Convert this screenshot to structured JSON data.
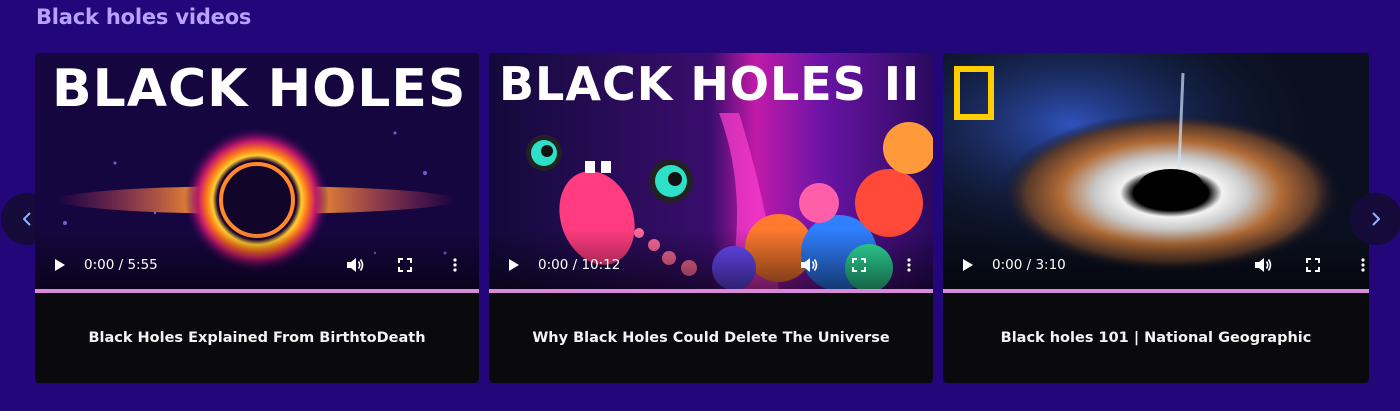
{
  "section": {
    "title": "Black holes videos"
  },
  "navigation": {
    "prev_icon": "chevron-left-icon",
    "next_icon": "chevron-right-icon"
  },
  "colors": {
    "page_background": "#23067a",
    "title_color": "#b7a3ff",
    "card_background": "#0a0a0e",
    "progress_track": "#d88ad8"
  },
  "videos": [
    {
      "thumbnail_text": "BLACK HOLES",
      "time": "0:00 / 5:55",
      "caption": "Black Holes Explained From BirthtoDeath",
      "progress": 0
    },
    {
      "thumbnail_text": "BLACK HOLES II",
      "time": "0:00 / 10:12",
      "caption": "Why Black Holes Could Delete The Universe",
      "progress": 0
    },
    {
      "thumbnail_text": "",
      "time": "0:00 / 3:10",
      "caption": "Black holes 101 | National Geographic",
      "progress": 0
    }
  ]
}
